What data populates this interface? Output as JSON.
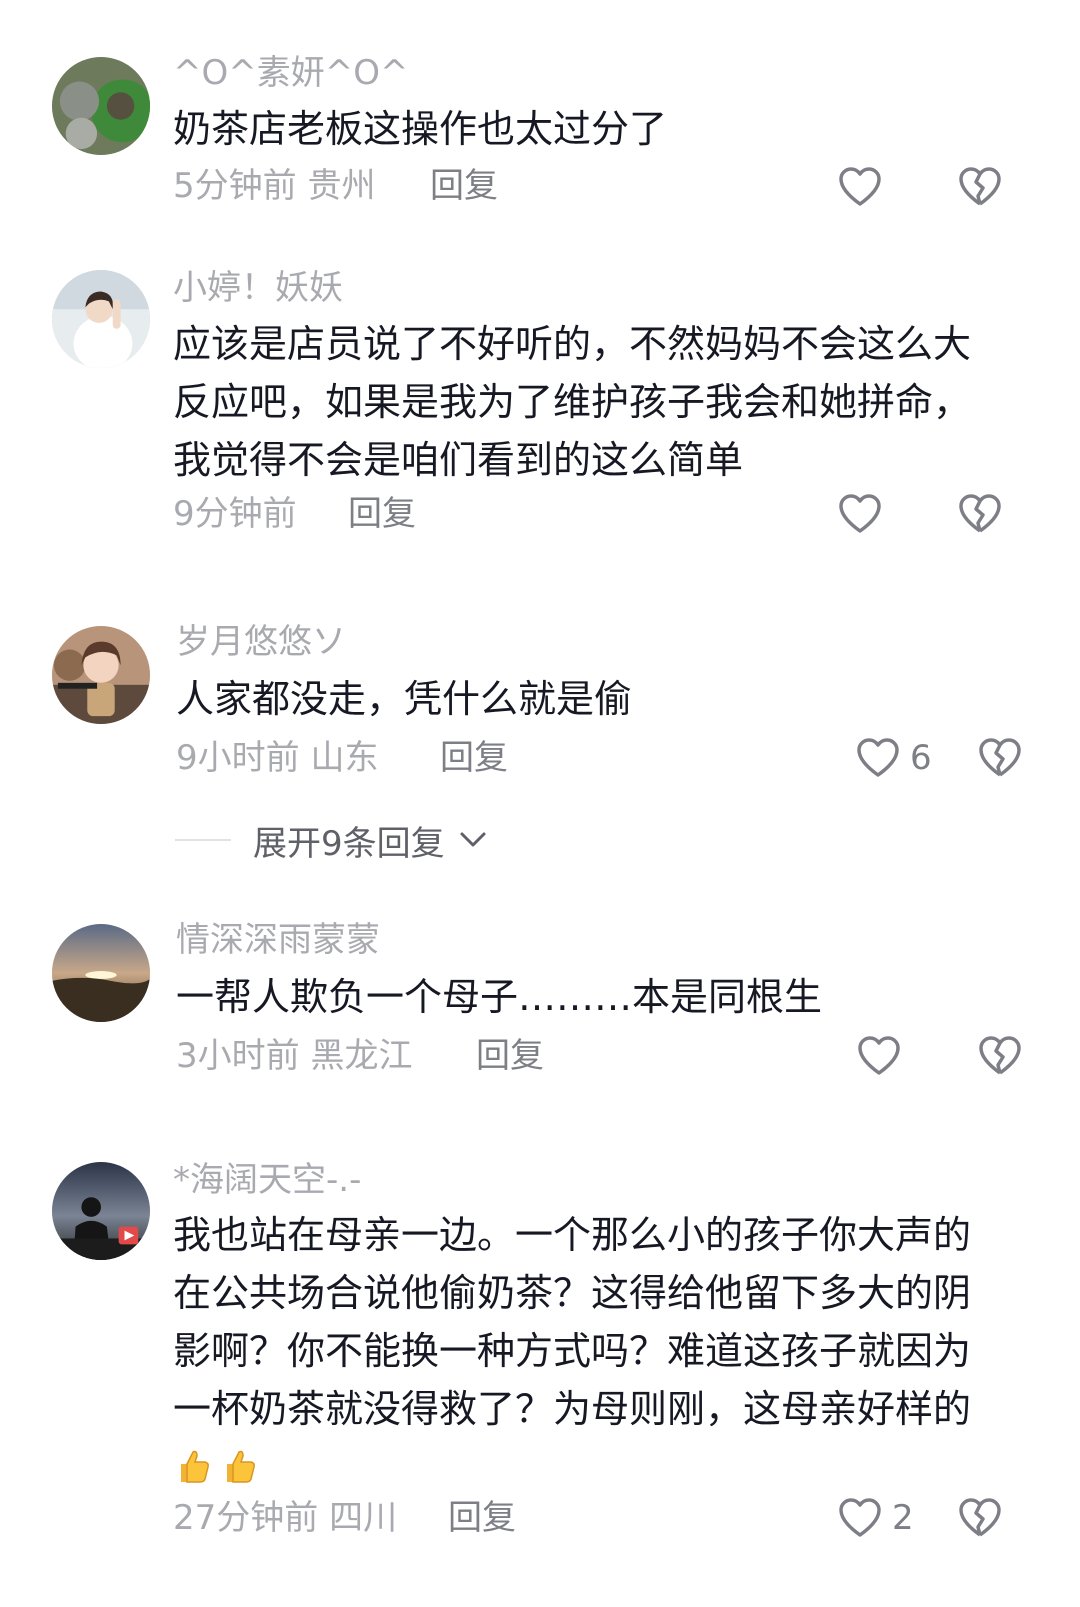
{
  "comments": [
    {
      "username": "^O^素妍^O^",
      "text": "奶茶店老板这操作也太过分了",
      "meta": "5分钟前 贵州",
      "reply": "回复",
      "likes": ""
    },
    {
      "username": "小婷！妖妖",
      "text": "应该是店员说了不好听的，不然妈妈不会这么大反应吧，如果是我为了维护孩子我会和她拼命，我觉得不会是咱们看到的这么简单",
      "meta": "9分钟前",
      "reply": "回复",
      "likes": ""
    },
    {
      "username": "岁月悠悠ソ",
      "text": "人家都没走，凭什么就是偷",
      "meta": "9小时前 山东",
      "reply": "回复",
      "likes": "6"
    },
    {
      "username": "情深深雨蒙蒙",
      "text": "一帮人欺负一个母子………本是同根生",
      "meta": "3小时前 黑龙江",
      "reply": "回复",
      "likes": ""
    },
    {
      "username": "*海阔天空-.-",
      "text": "我也站在母亲一边。一个那么小的孩子你大声的在公共场合说他偷奶茶？这得给他留下多大的阴影啊？你不能换一种方式吗？难道这孩子就因为一杯奶茶就没得救了？为母则刚，这母亲好样的",
      "meta": "27分钟前 四川",
      "reply": "回复",
      "likes": "2"
    }
  ],
  "expand_replies": "展开9条回复",
  "icons": {
    "like": "heart-outline-icon",
    "dislike": "broken-heart-icon",
    "expand": "chevron-down-icon",
    "emoji": "thumbs-up-emoji"
  },
  "colors": {
    "text": "#161823",
    "secondary": "#a9aab0",
    "icon": "#7e7f86"
  }
}
